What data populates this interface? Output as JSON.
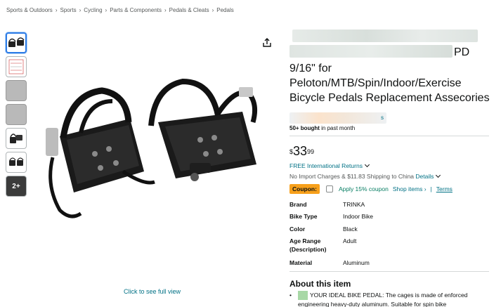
{
  "breadcrumb": [
    "Sports & Outdoors",
    "Sports",
    "Cycling",
    "Parts & Components",
    "Pedals & Cleats",
    "Pedals"
  ],
  "breadcrumb_separator": "›",
  "thumbnails": {
    "more_label": "2+"
  },
  "icons": {
    "share": "share-icon",
    "chevron": "chevron-down-icon"
  },
  "product": {
    "title_tail": "PD",
    "title_line3": "9/16\" for",
    "title_line4": "Peloton/MTB/Spin/Indoor/Exercise",
    "title_line5": "Bicycle Pedals Replacement Assecories",
    "rating_tail": "s",
    "bought_bold": "50+ bought",
    "bought_rest": " in past month",
    "price_symbol": "$",
    "price_whole": "33",
    "price_fraction": "99"
  },
  "shipping": {
    "returns": "FREE International Returns",
    "line": "No Import Charges & $11.83 Shipping to China",
    "details": "Details"
  },
  "coupon": {
    "badge": "Coupon:",
    "text": "Apply 15% coupon",
    "shop_items": "Shop items ›",
    "pipe": "|",
    "terms": "Terms"
  },
  "specs": [
    {
      "key": "Brand",
      "value": "TRINKA"
    },
    {
      "key": "Bike Type",
      "value": "Indoor Bike"
    },
    {
      "key": "Color",
      "value": "Black"
    },
    {
      "key": "Age Range (Description)",
      "value": "Adult"
    },
    {
      "key": "Material",
      "value": "Aluminum"
    }
  ],
  "about": {
    "title": "About this item",
    "bullet_marker": "•",
    "bullet1": "YOUR IDEAL BIKE PEDAL: The cages is made of enforced engineering heavy-duty aluminum. Suitable for spin bike"
  },
  "main_image": {
    "full_view": "Click to see full view"
  },
  "colors": {
    "link": "#007185",
    "coupon_badge": "#f7a01b",
    "coupon_text": "#067d62",
    "thumb_active_border": "#2d7ce6"
  }
}
